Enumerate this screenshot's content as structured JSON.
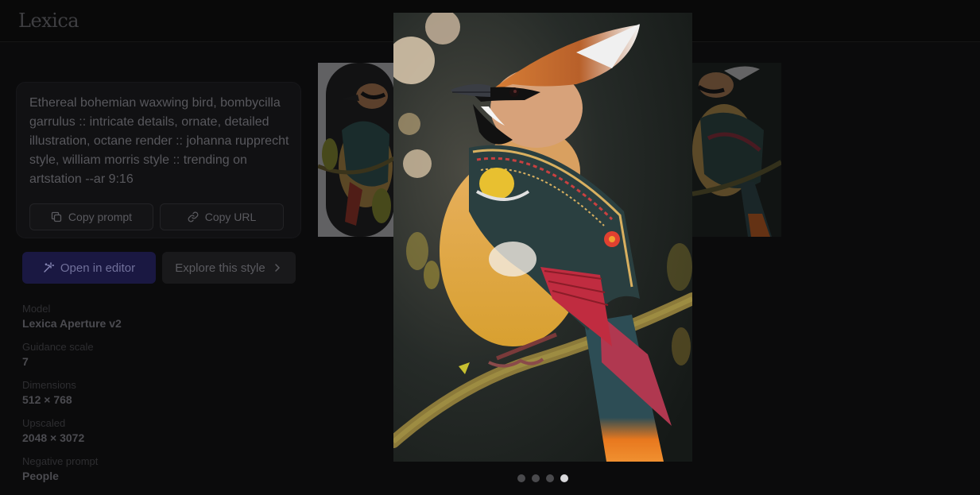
{
  "app": {
    "logo": "Lexica"
  },
  "prompt": {
    "text": "Ethereal bohemian waxwing bird, bombycilla garrulus :: intricate details, ornate, detailed illustration, octane render :: johanna rupprecht style, william morris style :: trending on artstation --ar 9:16",
    "copy_prompt_label": "Copy prompt",
    "copy_url_label": "Copy URL"
  },
  "actions": {
    "open_editor_label": "Open in editor",
    "explore_style_label": "Explore this style"
  },
  "metadata": [
    {
      "label": "Model",
      "value": "Lexica Aperture v2"
    },
    {
      "label": "Guidance scale",
      "value": "7"
    },
    {
      "label": "Dimensions",
      "value": "512 × 768"
    },
    {
      "label": "Upscaled",
      "value": "2048 × 3072"
    },
    {
      "label": "Negative prompt",
      "value": "People"
    }
  ],
  "carousel": {
    "total": 4,
    "active_index": 3
  },
  "colors": {
    "accent_button": "#1a1842",
    "background": "#0b0b0c"
  }
}
